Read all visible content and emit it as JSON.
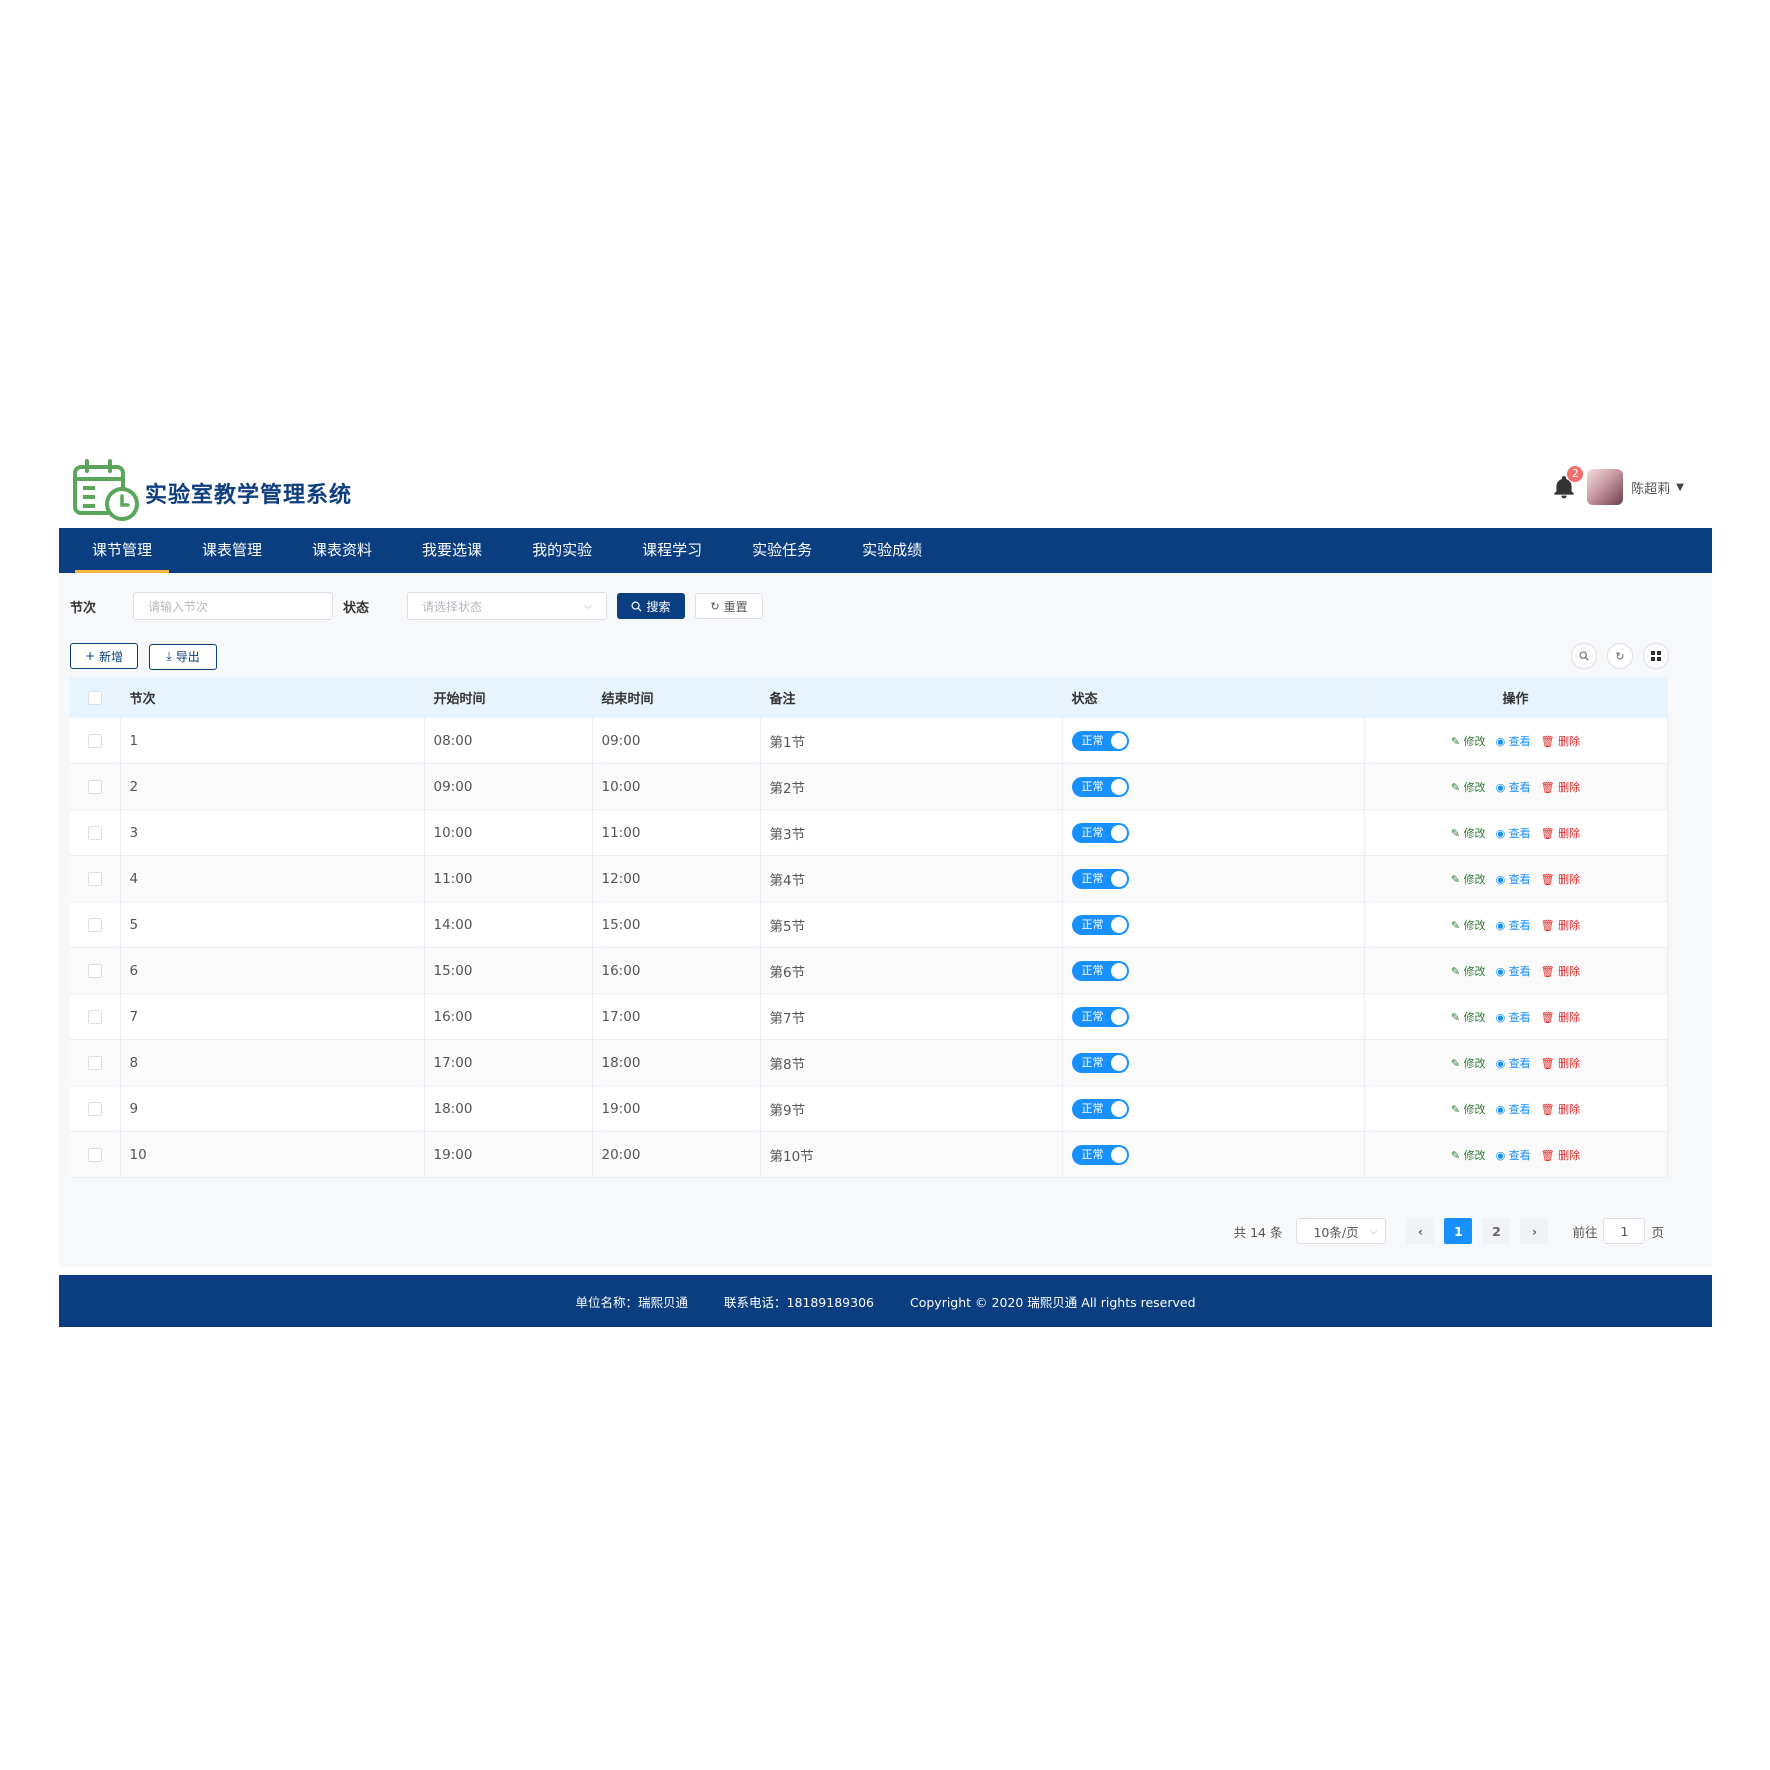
{
  "app": {
    "title": "实验室教学管理系统"
  },
  "user": {
    "name": "陈超莉",
    "notifications": "2"
  },
  "nav": {
    "items": [
      {
        "label": "课节管理",
        "active": true
      },
      {
        "label": "课表管理"
      },
      {
        "label": "课表资料"
      },
      {
        "label": "我要选课"
      },
      {
        "label": "我的实验"
      },
      {
        "label": "课程学习"
      },
      {
        "label": "实验任务"
      },
      {
        "label": "实验成绩"
      }
    ]
  },
  "search": {
    "section_label": "节次",
    "section_placeholder": "请输入节次",
    "status_label": "状态",
    "status_placeholder": "请选择状态",
    "search_btn": "搜索",
    "reset_btn": "重置"
  },
  "toolbar": {
    "add": "新增",
    "export": "导出"
  },
  "table": {
    "columns": [
      "节次",
      "开始时间",
      "结束时间",
      "备注",
      "状态",
      "操作"
    ],
    "status_text": "正常",
    "actions": {
      "edit": "修改",
      "view": "查看",
      "delete": "删除"
    },
    "rows": [
      {
        "section": "1",
        "start": "08:00",
        "end": "09:00",
        "remark": "第1节"
      },
      {
        "section": "2",
        "start": "09:00",
        "end": "10:00",
        "remark": "第2节"
      },
      {
        "section": "3",
        "start": "10:00",
        "end": "11:00",
        "remark": "第3节"
      },
      {
        "section": "4",
        "start": "11:00",
        "end": "12:00",
        "remark": "第4节"
      },
      {
        "section": "5",
        "start": "14:00",
        "end": "15:00",
        "remark": "第5节"
      },
      {
        "section": "6",
        "start": "15:00",
        "end": "16:00",
        "remark": "第6节"
      },
      {
        "section": "7",
        "start": "16:00",
        "end": "17:00",
        "remark": "第7节"
      },
      {
        "section": "8",
        "start": "17:00",
        "end": "18:00",
        "remark": "第8节"
      },
      {
        "section": "9",
        "start": "18:00",
        "end": "19:00",
        "remark": "第9节"
      },
      {
        "section": "10",
        "start": "19:00",
        "end": "20:00",
        "remark": "第10节"
      }
    ]
  },
  "pagination": {
    "total": "共 14 条",
    "page_size": "10条/页",
    "pages": [
      "1",
      "2"
    ],
    "current": "1",
    "goto_label": "前往",
    "goto_value": "1",
    "page_suffix": "页"
  },
  "footer": {
    "org": "单位名称：瑞熙贝通",
    "phone": "联系电话：18189189306",
    "copyright": "Copyright © 2020 瑞熙贝通 All rights reserved"
  },
  "colors": {
    "brand": "#0a3e80",
    "nav_active_underline": "#f4b63c",
    "switch_on": "#1890ff",
    "delete": "#e02b2b",
    "edit": "#2f7a3a"
  },
  "icons": [
    "calendar-clock-logo",
    "bell-icon",
    "search-icon",
    "refresh-icon",
    "plus-icon",
    "download-icon",
    "grid-icon",
    "edit-icon",
    "eye-icon",
    "trash-icon",
    "chevron-down-icon",
    "chevron-left-icon",
    "chevron-right-icon"
  ]
}
